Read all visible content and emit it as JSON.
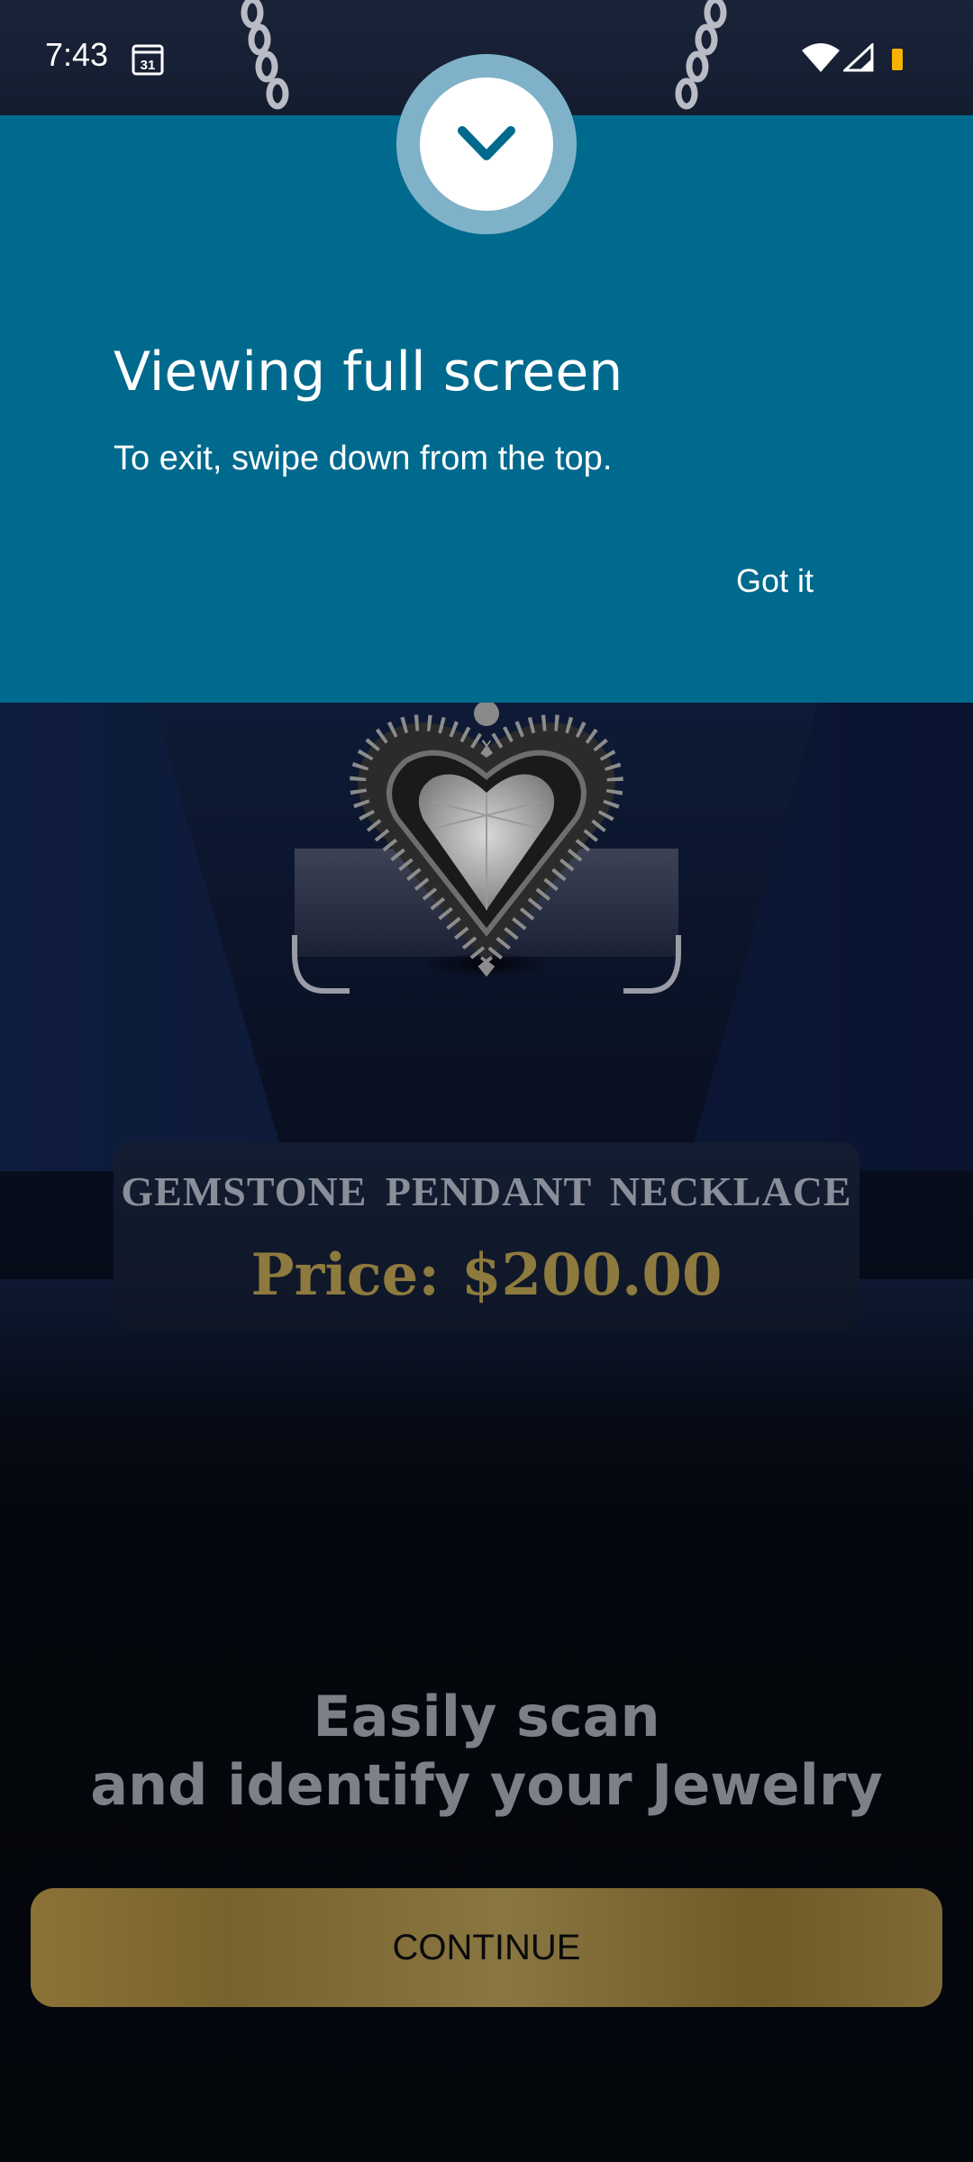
{
  "status_bar": {
    "time": "7:43",
    "calendar_day": "31",
    "icons": [
      "calendar-icon",
      "wifi-icon",
      "cell-signal-icon",
      "battery-low-icon"
    ],
    "battery_color": "#f5b400"
  },
  "fullscreen_notice": {
    "title": "Viewing full screen",
    "message": "To exit, swipe down from the top.",
    "dismiss_label": "Got it",
    "background_color": "#006a8e",
    "icon": "chevron-down-icon"
  },
  "product": {
    "name": "GEMSTONE PENDANT NECKLACE",
    "price_label": "Price:",
    "price_value": "$200.00",
    "image": "heart-pendant-necklace"
  },
  "onboarding": {
    "tagline_line1": "Easily scan",
    "tagline_line2": "and identify your Jewelry",
    "continue_label": "CONTINUE",
    "accent_color": "#8a7339"
  }
}
